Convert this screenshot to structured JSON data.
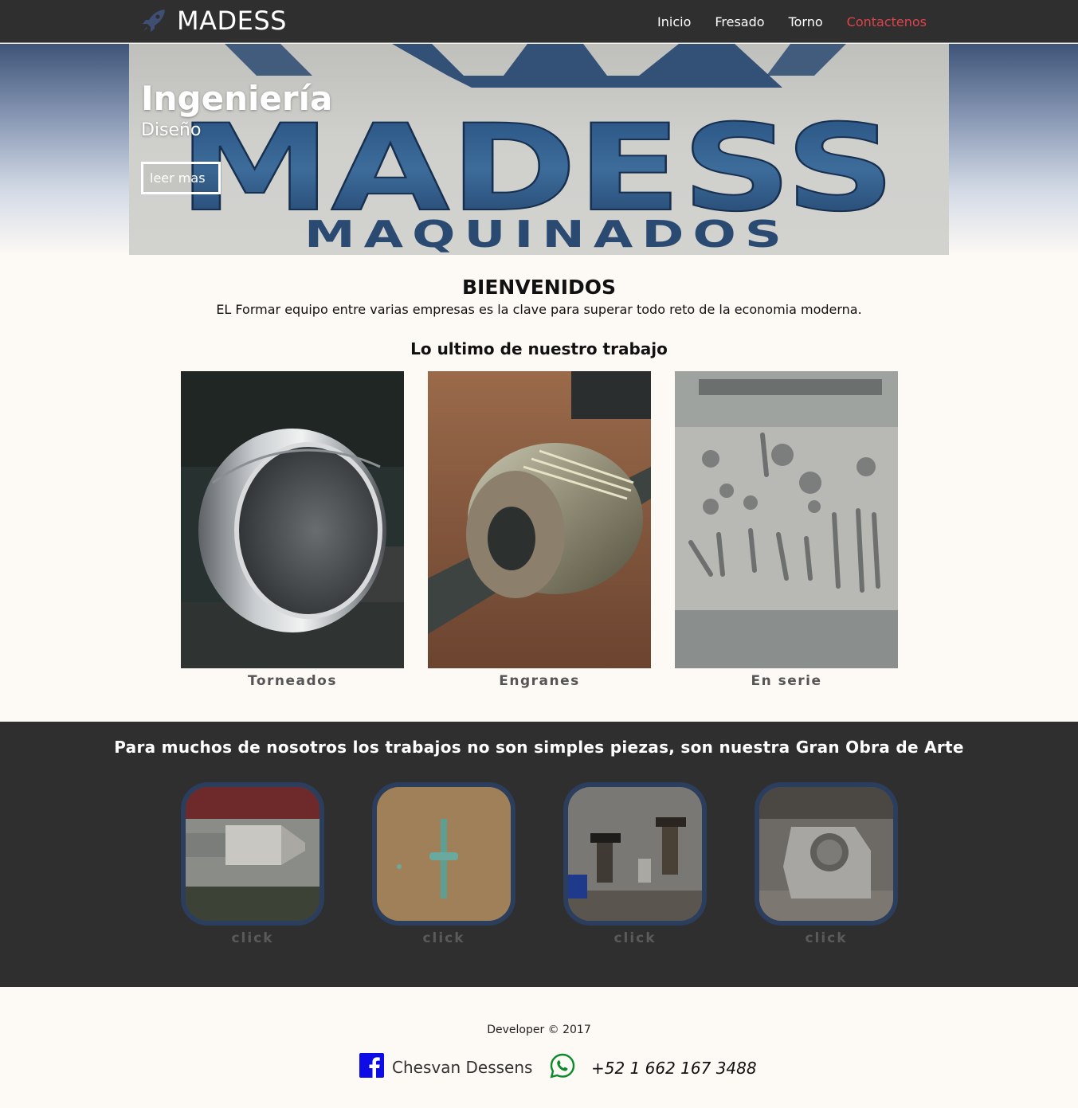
{
  "navbar": {
    "brand": "MADESS",
    "brand_icon": "rocket-icon",
    "links": [
      {
        "label": "Inicio",
        "active": false
      },
      {
        "label": "Fresado",
        "active": false
      },
      {
        "label": "Torno",
        "active": false
      },
      {
        "label": "Contactenos",
        "active": true
      }
    ],
    "active_color": "#e0434a"
  },
  "hero": {
    "title": "Ingeniería",
    "subtitle": "Diseño",
    "button": "leer mas",
    "image_text_1": "MADESS",
    "image_text_2": "MAQUINADOS"
  },
  "welcome": {
    "title": "BIENVENIDOS",
    "text": "EL Formar equipo entre varias empresas es la clave para superar todo reto de la economia moderna."
  },
  "works": {
    "title": "Lo ultimo de nuestro trabajo",
    "items": [
      {
        "caption": "Torneados"
      },
      {
        "caption": "Engranes"
      },
      {
        "caption": "En serie"
      }
    ]
  },
  "gallery": {
    "title": "Para muchos de nosotros los trabajos no son simples piezas, son nuestra Gran Obra de Arte",
    "items": [
      {
        "label": "click"
      },
      {
        "label": "click"
      },
      {
        "label": "click"
      },
      {
        "label": "click"
      }
    ],
    "frame_color": "#2c3e5e"
  },
  "footer": {
    "developer": "Developer © 2017",
    "facebook": {
      "icon": "facebook-icon",
      "label": "Chesvan Dessens"
    },
    "whatsapp": {
      "icon": "whatsapp-icon",
      "label": "+52 1 662 167 3488"
    }
  }
}
